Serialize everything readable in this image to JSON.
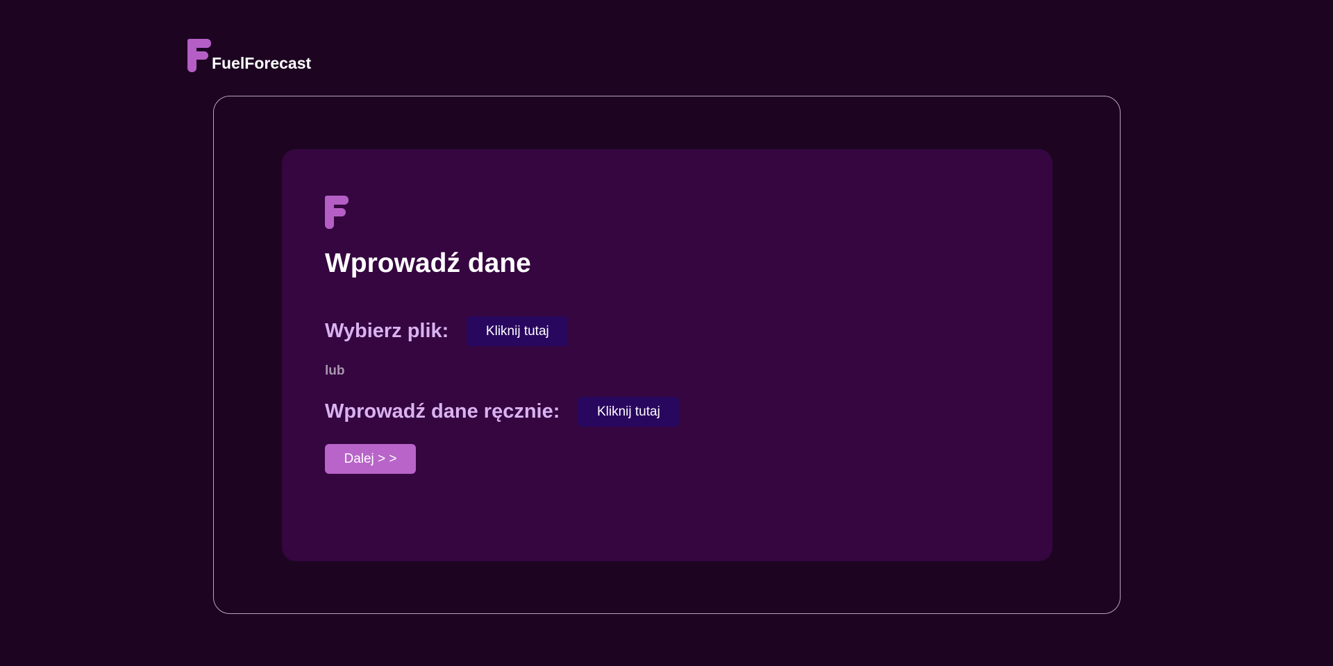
{
  "header": {
    "brand_name": "FuelForecast",
    "logo_icon": "fuelforecast-f-logo"
  },
  "card": {
    "logo_icon": "fuelforecast-f-logo",
    "title": "Wprowadź dane",
    "file_row": {
      "label": "Wybierz plik:",
      "button_label": "Kliknij tutaj"
    },
    "separator": "lub",
    "manual_row": {
      "label": "Wprowadź dane ręcznie:",
      "button_label": "Kliknij tutaj"
    },
    "next_button_label": "Dalej > >"
  },
  "colors": {
    "background": "#1d0522",
    "card": "#350640",
    "accent": "#b864c8",
    "secondary_button": "#28075f",
    "label": "#d9b3f0"
  }
}
